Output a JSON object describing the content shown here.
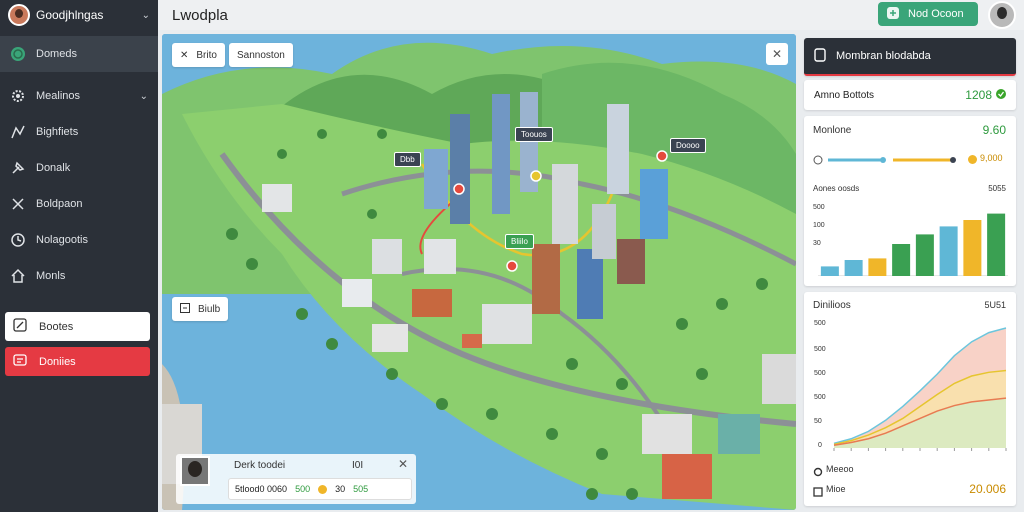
{
  "sidebar": {
    "title": "Goodjhlngas",
    "items": [
      {
        "label": "Domeds",
        "icon": "globe-icon"
      },
      {
        "label": "Mealinos",
        "icon": "gear-icon"
      },
      {
        "label": "Bighfiets",
        "icon": "chart-icon"
      },
      {
        "label": "Donalk",
        "icon": "pin-icon"
      },
      {
        "label": "Boldpaon",
        "icon": "tools-icon"
      },
      {
        "label": "Nolagootis",
        "icon": "clock-icon"
      },
      {
        "label": "Monls",
        "icon": "home-icon"
      }
    ],
    "card_white": "Bootes",
    "card_red": "Doniies"
  },
  "topbar": {
    "title": "Lwodpla",
    "button_label": "Nod Ocoon"
  },
  "map": {
    "chip_left": "Brito",
    "chip_mid": "Sannoston",
    "chip_side": "Biulb",
    "tags": [
      "Dbb",
      "Toouos",
      "Bliilo",
      "Doooo"
    ],
    "info": {
      "title": "Derk toodei",
      "value": "I0I",
      "bar_left": "5tlood0 0060",
      "bar_green": "500",
      "bar_mid": "30",
      "bar_right": "505"
    }
  },
  "panels": {
    "header": "Mombran blodabda",
    "row_label": "Amno Bottots",
    "row_value": "1208",
    "chart1": {
      "title": "Monlone",
      "value": "9.60",
      "slider_value": "9,000",
      "sub_label": "Aones oosds",
      "sub_value": "5055",
      "yticks": [
        "500",
        "100",
        "30"
      ]
    },
    "chart2": {
      "title": "Dinilioos",
      "value": "5U51",
      "yticks": [
        "500",
        "500",
        "500",
        "500",
        "50",
        "0"
      ],
      "legend1": "Meeoo",
      "legend2": "Mioe",
      "footer_value": "20.006"
    }
  },
  "chart_data": [
    {
      "type": "bar",
      "categories": [
        "",
        "",
        "",
        "",
        "",
        "",
        "",
        ""
      ],
      "series": [
        {
          "values": [
            12,
            20,
            22,
            40,
            52,
            62,
            70,
            78
          ]
        }
      ],
      "ylim": [
        0,
        100
      ]
    },
    {
      "type": "area",
      "x": [
        0,
        1,
        2,
        3,
        4,
        5,
        6,
        7,
        8,
        9,
        10
      ],
      "series": [
        {
          "values": [
            5,
            10,
            18,
            30,
            45,
            62,
            80,
            100,
            115,
            125,
            130
          ]
        },
        {
          "values": [
            4,
            8,
            14,
            22,
            32,
            45,
            58,
            70,
            78,
            82,
            84
          ]
        },
        {
          "values": [
            3,
            6,
            10,
            16,
            24,
            32,
            40,
            46,
            50,
            52,
            54
          ]
        }
      ]
    }
  ],
  "colors": {
    "accent_green": "#3aa579",
    "accent_red": "#e53a43",
    "sidebar_bg": "#2b3038"
  }
}
